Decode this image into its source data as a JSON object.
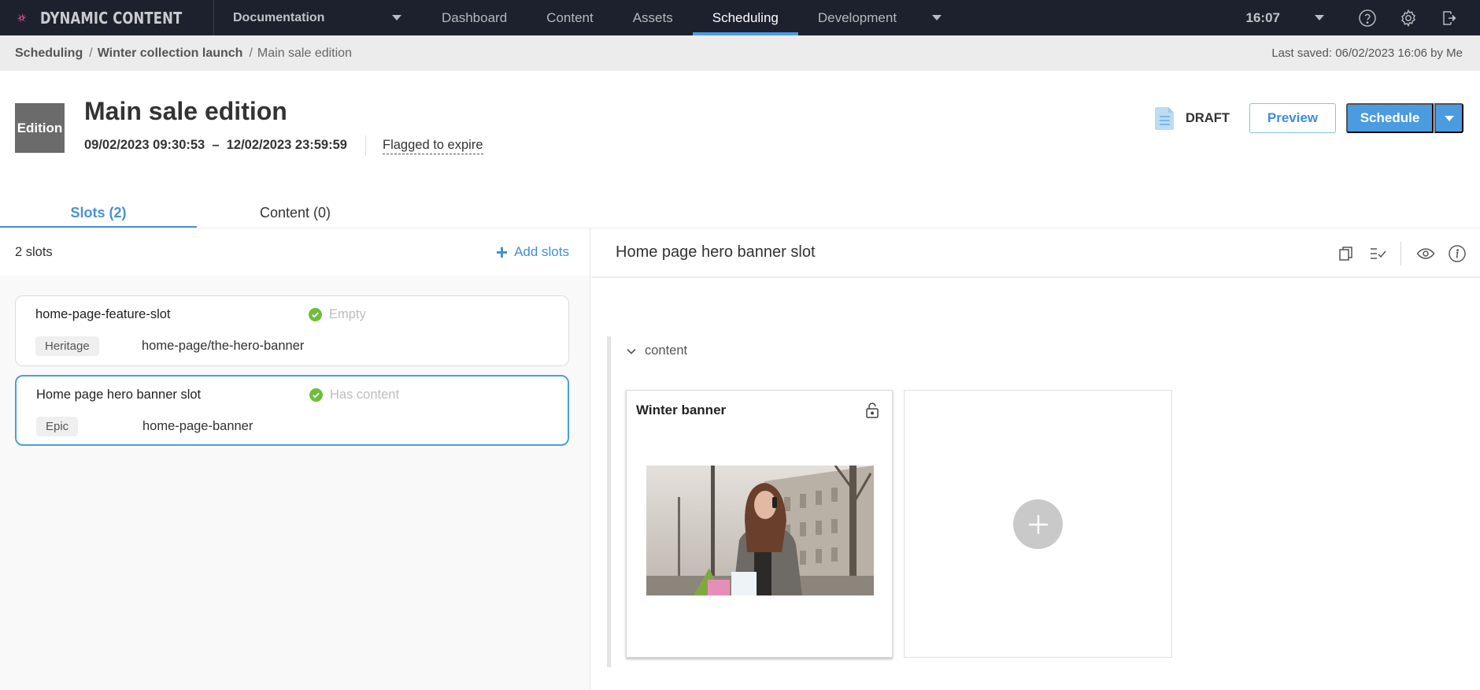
{
  "app": {
    "name": "DYNAMIC CONTENT",
    "hub": "Documentation",
    "nav_tabs": [
      {
        "label": "Dashboard",
        "active": false
      },
      {
        "label": "Content",
        "active": false
      },
      {
        "label": "Assets",
        "active": false
      },
      {
        "label": "Scheduling",
        "active": true
      },
      {
        "label": "Development",
        "active": false
      }
    ],
    "time": "16:07",
    "icons": [
      "help-icon",
      "settings-icon",
      "logout-icon"
    ]
  },
  "breadcrumb": {
    "items": [
      "Scheduling",
      "Winter collection launch"
    ],
    "current": "Main sale edition",
    "separator": "/",
    "last_saved": "Last saved: 06/02/2023 16:06 by Me"
  },
  "edition": {
    "badge": "Edition",
    "title": "Main sale edition",
    "date_range": "09/02/2023 09:30:53  –  12/02/2023 23:59:59",
    "flag": "Flagged to expire",
    "status": "DRAFT",
    "preview_label": "Preview",
    "schedule_label": "Schedule"
  },
  "tabs": [
    {
      "label": "Slots (2)",
      "active": true
    },
    {
      "label": "Content (0)",
      "active": false
    }
  ],
  "slots_panel": {
    "count_label": "2 slots",
    "add_label": "Add slots",
    "slots": [
      {
        "name": "home-page-feature-slot",
        "status": "Empty",
        "tag": "Heritage",
        "key": "home-page/the-hero-banner",
        "selected": false
      },
      {
        "name": "Home page hero banner slot",
        "status": "Has content",
        "tag": "Epic",
        "key": "home-page-banner",
        "selected": true
      }
    ]
  },
  "detail_panel": {
    "title": "Home page hero banner slot",
    "tools": [
      "copy-icon",
      "validate-icon",
      "preview-eye-icon",
      "info-icon"
    ],
    "section_label": "content",
    "cards": [
      {
        "title": "Winter banner",
        "locked": false,
        "image": "woman-shopping-street-photo"
      },
      {
        "title": "",
        "empty": true
      }
    ]
  },
  "colors": {
    "nav_bg": "#1d212d",
    "accent": "#4a9ee3",
    "success": "#6bbf3c"
  }
}
